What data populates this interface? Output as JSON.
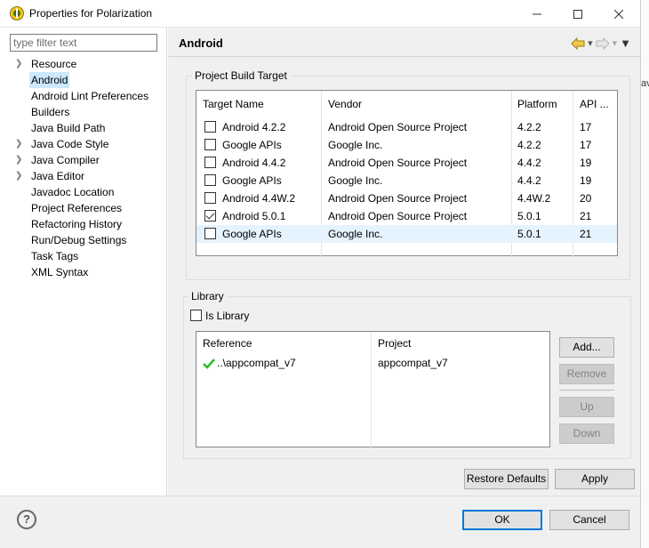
{
  "window": {
    "title": "Properties for Polarization"
  },
  "sidebar": {
    "filter_placeholder": "type filter text",
    "items": [
      {
        "label": "Resource",
        "expandable": true,
        "selected": false
      },
      {
        "label": "Android",
        "expandable": false,
        "selected": true
      },
      {
        "label": "Android Lint Preferences",
        "expandable": false,
        "selected": false
      },
      {
        "label": "Builders",
        "expandable": false,
        "selected": false
      },
      {
        "label": "Java Build Path",
        "expandable": false,
        "selected": false
      },
      {
        "label": "Java Code Style",
        "expandable": true,
        "selected": false
      },
      {
        "label": "Java Compiler",
        "expandable": true,
        "selected": false
      },
      {
        "label": "Java Editor",
        "expandable": true,
        "selected": false
      },
      {
        "label": "Javadoc Location",
        "expandable": false,
        "selected": false
      },
      {
        "label": "Project References",
        "expandable": false,
        "selected": false
      },
      {
        "label": "Refactoring History",
        "expandable": false,
        "selected": false
      },
      {
        "label": "Run/Debug Settings",
        "expandable": false,
        "selected": false
      },
      {
        "label": "Task Tags",
        "expandable": false,
        "selected": false
      },
      {
        "label": "XML Syntax",
        "expandable": false,
        "selected": false
      }
    ]
  },
  "page": {
    "title": "Android"
  },
  "build_target": {
    "group_title": "Project Build Target",
    "columns": [
      "Target Name",
      "Vendor",
      "Platform",
      "API ..."
    ],
    "rows": [
      {
        "name": "Android 4.2.2",
        "vendor": "Android Open Source Project",
        "platform": "4.2.2",
        "api": "17",
        "checked": false
      },
      {
        "name": "Google APIs",
        "vendor": "Google Inc.",
        "platform": "4.2.2",
        "api": "17",
        "checked": false
      },
      {
        "name": "Android 4.4.2",
        "vendor": "Android Open Source Project",
        "platform": "4.4.2",
        "api": "19",
        "checked": false
      },
      {
        "name": "Google APIs",
        "vendor": "Google Inc.",
        "platform": "4.4.2",
        "api": "19",
        "checked": false
      },
      {
        "name": "Android 4.4W.2",
        "vendor": "Android Open Source Project",
        "platform": "4.4W.2",
        "api": "20",
        "checked": false
      },
      {
        "name": "Android 5.0.1",
        "vendor": "Android Open Source Project",
        "platform": "5.0.1",
        "api": "21",
        "checked": true
      },
      {
        "name": "Google APIs",
        "vendor": "Google Inc.",
        "platform": "5.0.1",
        "api": "21",
        "checked": false
      }
    ]
  },
  "library": {
    "group_title": "Library",
    "is_library_label": "Is Library",
    "is_library_checked": false,
    "columns": [
      "Reference",
      "Project"
    ],
    "rows": [
      {
        "reference": "..\\appcompat_v7",
        "project": "appcompat_v7",
        "status_icon": "green-check-icon"
      }
    ],
    "buttons": {
      "add": "Add...",
      "remove": "Remove",
      "up": "Up",
      "down": "Down"
    }
  },
  "actions": {
    "restore_defaults": "Restore Defaults",
    "apply": "Apply",
    "ok": "OK",
    "cancel": "Cancel"
  },
  "edge_text": "av",
  "colors": {
    "selection": "#cce8ff",
    "row_highlight": "#e5f3ff",
    "default_button": "#0078d7",
    "check_green": "#2dbd2d"
  }
}
